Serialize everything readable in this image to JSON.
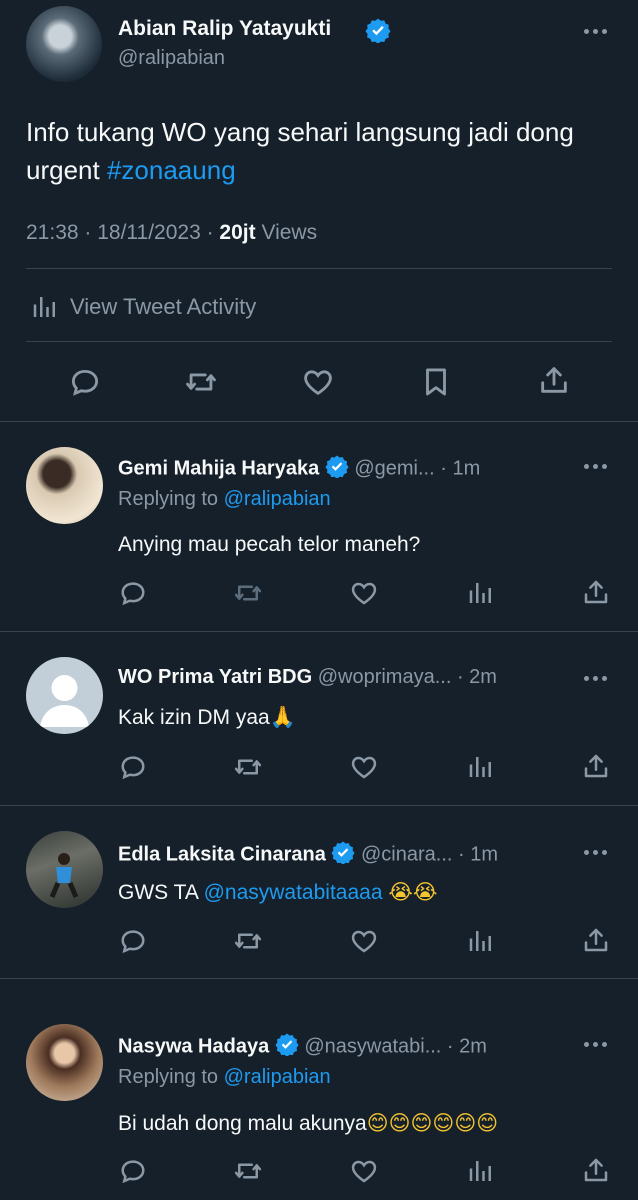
{
  "main_tweet": {
    "author_name": "Abian Ralip Yatayukti",
    "handle": "@ralipabian",
    "text": "Info tukang WO yang sehari langsung jadi dong urgent",
    "hashtag": "#zonaaung",
    "time": "21:38 · 18/11/2023 · ",
    "views_count": "20jt",
    "views_label": " Views",
    "activity_label": "View Tweet Activity"
  },
  "replies": [
    {
      "name": "Gemi Mahija Haryaka",
      "verified": true,
      "handle": "@gemi...",
      "time": "· 1m",
      "replying_prefix": "Replying to ",
      "replying_handle": "@ralipabian",
      "text": "Anying mau pecah telor maneh?"
    },
    {
      "name": "WO Prima Yatri BDG",
      "verified": false,
      "handle": "@woprimaya...",
      "time": "· 2m",
      "text": "Kak izin DM yaa",
      "emoji": "🙏"
    },
    {
      "name": "Edla Laksita Cinarana",
      "verified": true,
      "handle": "@cinara...",
      "time": "· 1m",
      "text_prefix": "GWS TA ",
      "mention": "@nasywatabitaaaa",
      "emojis": [
        "😭",
        "😭"
      ]
    },
    {
      "name": "Nasywa Hadaya",
      "verified": true,
      "handle": "@nasywatabi...",
      "time": "· 2m",
      "replying_prefix": "Replying to ",
      "replying_handle": "@ralipabian",
      "text": "Bi udah dong malu akunya",
      "emojis": [
        "😊",
        "😊",
        "😊",
        "😊",
        "😊",
        "😊"
      ]
    }
  ],
  "colors": {
    "background": "#15202b",
    "accent": "#1d9bf0",
    "muted": "#8b98a5",
    "divider": "#38444d"
  }
}
